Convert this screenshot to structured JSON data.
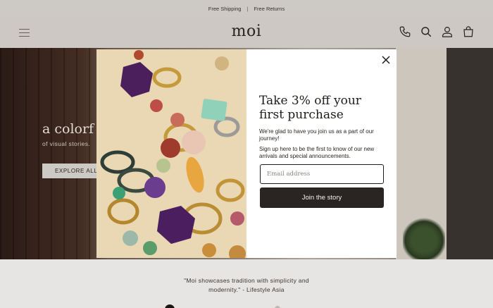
{
  "announcement": {
    "items": [
      "Free Shipping",
      "Free Returns"
    ],
    "separator": "|"
  },
  "header": {
    "logo": "moi",
    "icons": [
      "menu-icon",
      "phone-icon",
      "search-icon",
      "account-icon",
      "bag-icon"
    ]
  },
  "hero": {
    "title": "a colorf",
    "subtitle": "of visual stories.",
    "cta_label": "EXPLORE ALL"
  },
  "quote": {
    "line1": "\"Moi showcases tradition with simplicity and",
    "line2": "modernity.\" - Lifestyle Asia"
  },
  "modal": {
    "title": "Take 3% off your first purchase",
    "text1": "We're glad to have you join us as a part of our journey!",
    "text2": "Sign up here to be the first to know of our new arrivals and special announcements.",
    "email_placeholder": "Email address",
    "submit_label": "Join the story",
    "close_icon": "close-icon"
  },
  "colors": {
    "primary_dark": "#2a2522",
    "header_bg": "#d8d3ce",
    "modal_bg": "#ffffff"
  }
}
